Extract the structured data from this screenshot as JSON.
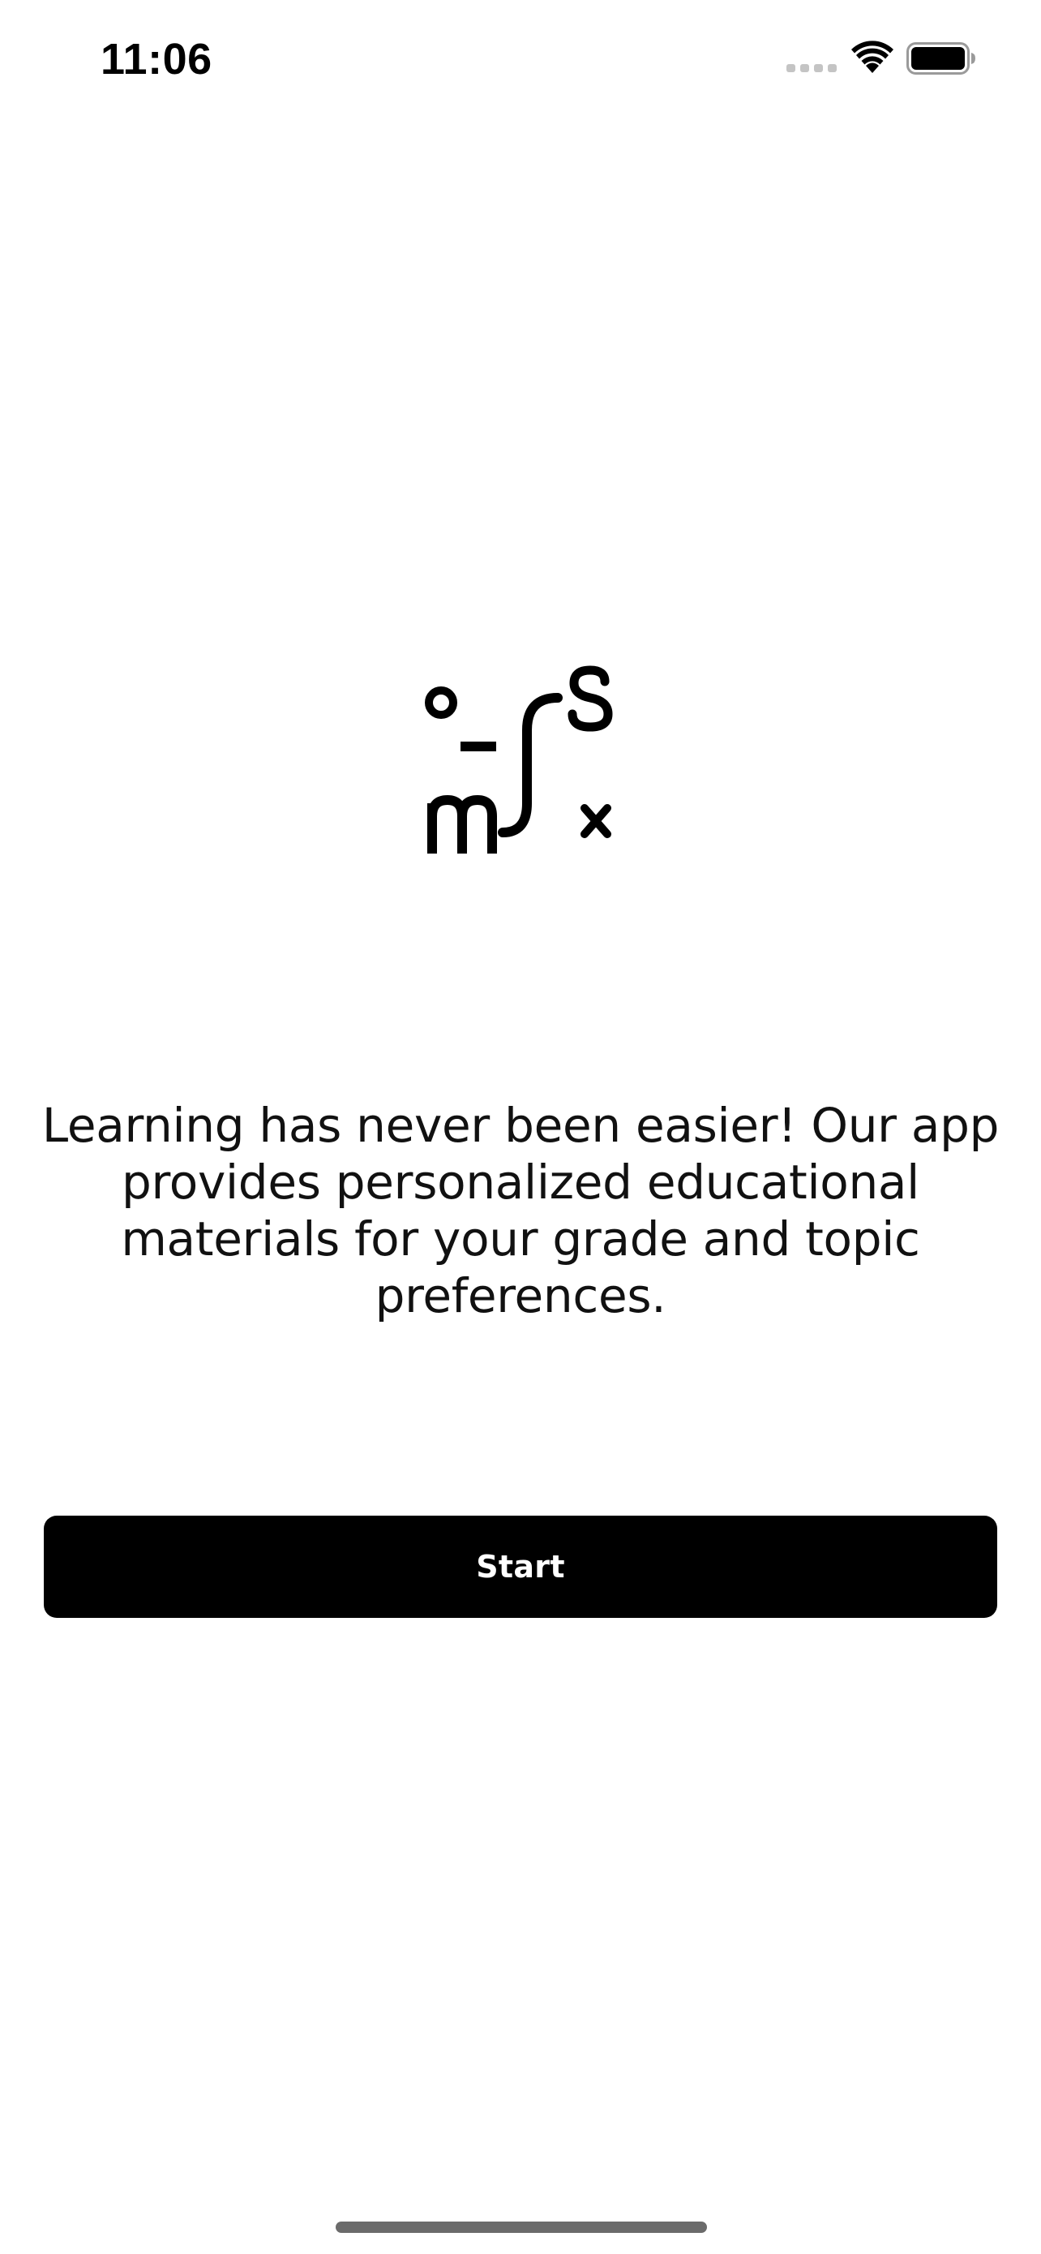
{
  "status_bar": {
    "time": "11:06",
    "signal_icon": "cellular-signal-icon",
    "wifi_icon": "wifi-icon",
    "battery_icon": "battery-icon"
  },
  "logo": {
    "icon": "app-logo-icon"
  },
  "onboarding": {
    "description": "Learning has never been easier! Our app provides personalized educational materials for your grade and topic preferences."
  },
  "start_button": {
    "label": "Start"
  },
  "colors": {
    "background": "#ffffff",
    "button_bg": "#000000",
    "button_text": "#ffffff",
    "text": "#111111"
  }
}
